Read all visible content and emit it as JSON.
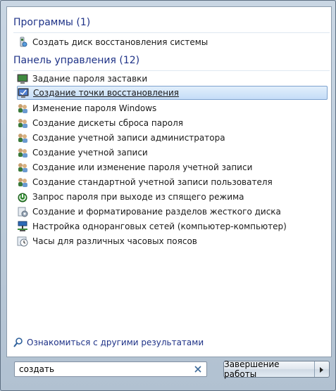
{
  "programs": {
    "header": "Программы (1)",
    "items": [
      {
        "label": "Создать диск восстановления системы",
        "icon": "recovery-disc-icon"
      }
    ]
  },
  "control_panel": {
    "header": "Панель управления (12)",
    "items": [
      {
        "label": "Задание пароля заставки",
        "icon": "monitor-icon"
      },
      {
        "label": "Создание точки восстановления",
        "icon": "system-monitor-icon",
        "selected": true
      },
      {
        "label": "Изменение пароля Windows",
        "icon": "users-icon"
      },
      {
        "label": "Создание дискеты сброса пароля",
        "icon": "users-icon"
      },
      {
        "label": "Создание учетной записи администратора",
        "icon": "users-icon"
      },
      {
        "label": "Создание учетной записи",
        "icon": "users-icon"
      },
      {
        "label": "Создание или изменение пароля учетной записи",
        "icon": "users-icon"
      },
      {
        "label": "Создание стандартной учетной записи пользователя",
        "icon": "users-icon"
      },
      {
        "label": "Запрос пароля при выходе из спящего режима",
        "icon": "power-icon"
      },
      {
        "label": "Создание и форматирование разделов жесткого диска",
        "icon": "admin-tools-icon"
      },
      {
        "label": "Настройка одноранговых сетей (компьютер-компьютер)",
        "icon": "network-icon"
      },
      {
        "label": "Часы для различных часовых поясов",
        "icon": "clock-icon"
      }
    ]
  },
  "more_results": {
    "label": "Ознакомиться с другими результатами",
    "icon": "search-icon"
  },
  "search": {
    "value": "создать",
    "clear_icon": "clear-icon"
  },
  "shutdown": {
    "label": "Завершение работы",
    "icon": "arrow-right-icon"
  },
  "colors": {
    "header": "#1e3287",
    "selection": "#c4dcf7",
    "selection_border": "#7da2ce"
  }
}
